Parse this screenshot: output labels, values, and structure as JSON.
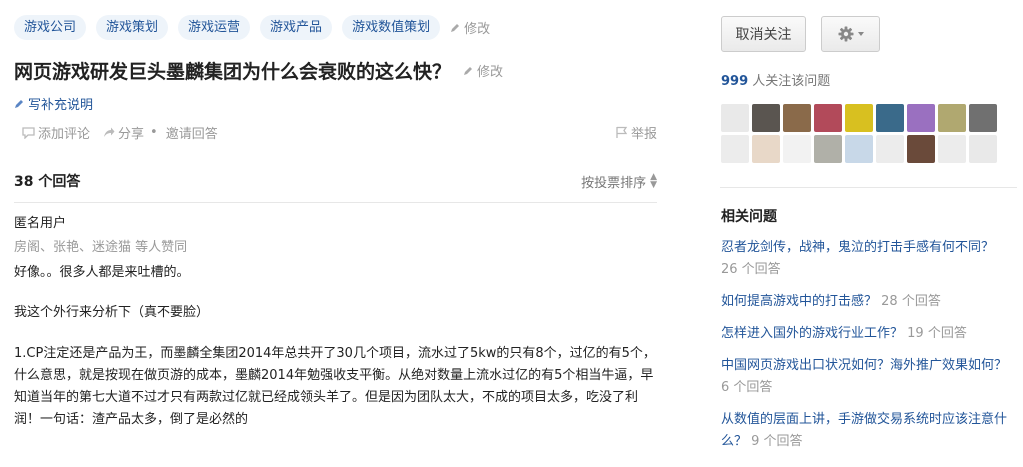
{
  "question": {
    "topics": [
      "游戏公司",
      "游戏策划",
      "游戏运营",
      "游戏产品",
      "游戏数值策划"
    ],
    "topics_edit": "修改",
    "title": "网页游戏研发巨头墨麟集团为什么会衰败的这么快？",
    "title_edit": "修改",
    "supplement": "写补充说明",
    "actions": {
      "comment": "添加评论",
      "share": "分享",
      "dot": "•",
      "invite": "邀请回答",
      "report": "举报"
    }
  },
  "answers": {
    "count_label": "38 个回答",
    "sort_label": "按投票排序"
  },
  "answer": {
    "author": "匿名用户",
    "voters": "房阁、张艳、迷途猫 等人赞同",
    "paragraphs": [
      "好像。。很多人都是来吐槽的。",
      "我这个外行来分析下（真不要脸）",
      "1.CP注定还是产品为王，而墨麟全集团2014年总共开了30几个项目，流水过了5kw的只有8个，过亿的有5个，什么意思，就是按现在做页游的成本，墨麟2014年勉强收支平衡。从绝对数量上流水过亿的有5个相当牛逼，早知道当年的第七大道不过才只有两款过亿就已经成领头羊了。但是因为团队太大，不成的项目太多，吃没了利润！一句话：渣产品太多，倒了是必然的"
    ]
  },
  "sidebar": {
    "unfollow_button": "取消关注",
    "settings_icon": "gear-icon",
    "followers_count": "999",
    "followers_text": "人关注该问题",
    "related_title": "相关问题",
    "related": [
      {
        "q": "忍者龙剑传，战神，鬼泣的打击手感有何不同？",
        "count": "26 个回答"
      },
      {
        "q": "如何提高游戏中的打击感？",
        "count": "28 个回答"
      },
      {
        "q": "怎样进入国外的游戏行业工作？",
        "count": "19 个回答"
      },
      {
        "q": "中国网页游戏出口状况如何？海外推广效果如何？",
        "count": "6 个回答"
      },
      {
        "q": "从数值的层面上讲，手游做交易系统时应该注意什么？",
        "count": "9 个回答"
      }
    ]
  },
  "colors": {
    "link": "#225599",
    "tag_bg": "#eef4fa",
    "muted": "#999999"
  }
}
